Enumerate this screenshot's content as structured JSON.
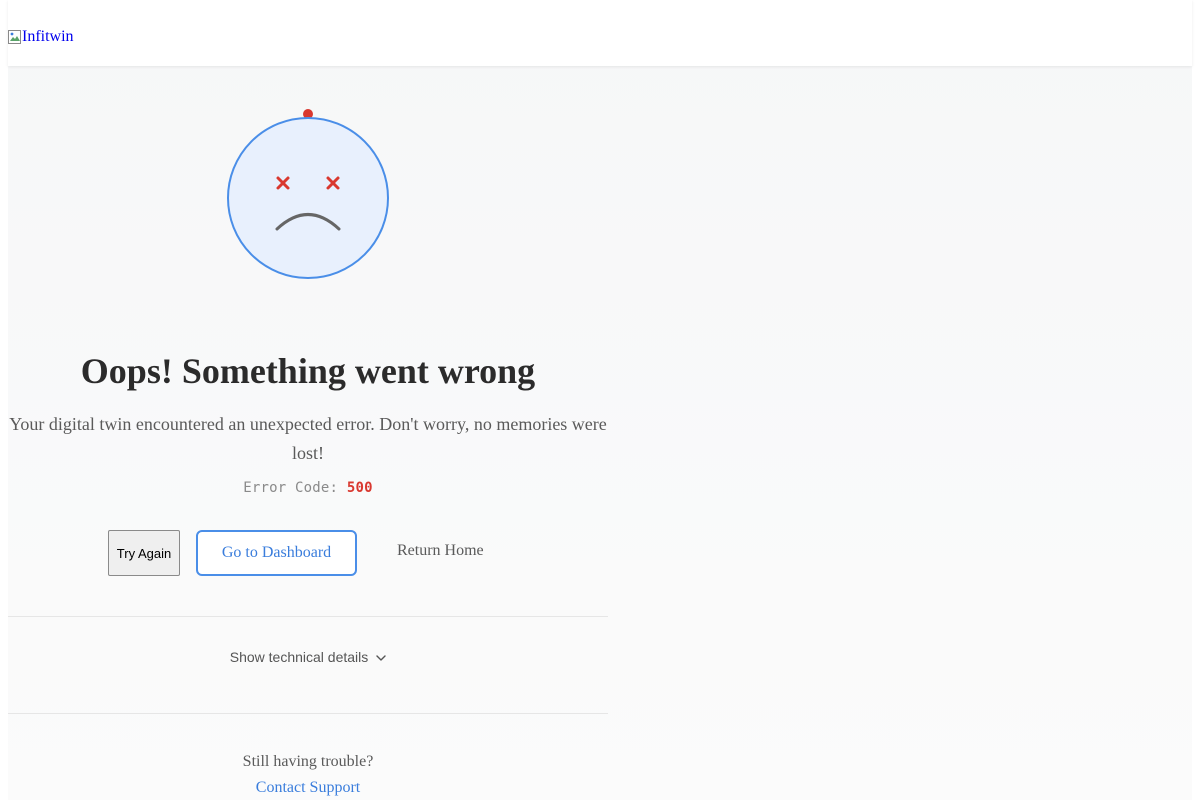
{
  "header": {
    "logo_alt": "Infitwin"
  },
  "error": {
    "title": "Oops! Something went wrong",
    "message": "Your digital twin encountered an unexpected error. Don't worry, no memories were lost!",
    "code_label": "Error Code:",
    "code_value": "500"
  },
  "actions": {
    "try_again": "Try Again",
    "dashboard": "Go to Dashboard",
    "home": "Return Home"
  },
  "details": {
    "toggle_label": "Show technical details"
  },
  "support": {
    "prompt": "Still having trouble?",
    "link_label": "Contact Support"
  },
  "colors": {
    "accent": "#4a8ee8",
    "error_red": "#d9382f",
    "face_fill": "#e8f0fd",
    "text_dark": "#2b2b2b",
    "text_muted": "#5a5a5a"
  },
  "icons": {
    "logo": "broken-image-icon",
    "illustration": "sad-face-icon",
    "toggle": "chevron-down-icon"
  }
}
